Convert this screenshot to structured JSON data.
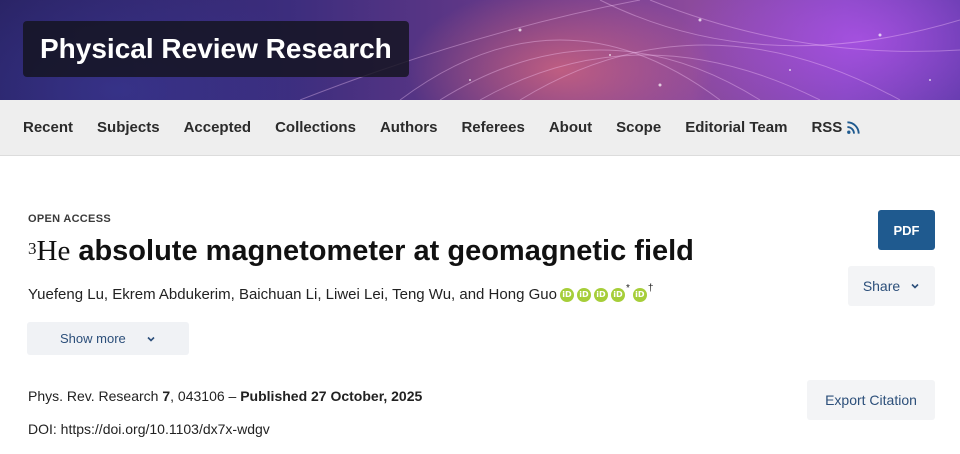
{
  "header": {
    "journal_title": "Physical Review Research"
  },
  "nav": {
    "items": [
      "Recent",
      "Subjects",
      "Accepted",
      "Collections",
      "Authors",
      "Referees",
      "About",
      "Scope",
      "Editorial Team",
      "RSS"
    ]
  },
  "article": {
    "access_label": "OPEN ACCESS",
    "title_isotope_mass": "3",
    "title_element": "He",
    "title_rest": "absolute magnetometer at geomagnetic field",
    "authors": "Yuefeng Lu, Ekrem Abdukerim, Baichuan Li, Liwei Lei, Teng Wu, and Hong Guo",
    "orcid_label": "iD",
    "mark_star": "*",
    "mark_dagger": "†",
    "show_more_label": "Show more",
    "journal_abbrev": "Phys. Rev. Research",
    "volume": "7",
    "article_number": ", 043106 – ",
    "published": "Published 27 October, 2025",
    "doi": "DOI: https://doi.org/10.1103/dx7x-wdgv"
  },
  "actions": {
    "pdf_label": "PDF",
    "share_label": "Share",
    "export_label": "Export Citation"
  },
  "colors": {
    "pdf_button": "#1f5a8f",
    "orcid": "#a6ce39",
    "link_text": "#2c4f7a"
  }
}
